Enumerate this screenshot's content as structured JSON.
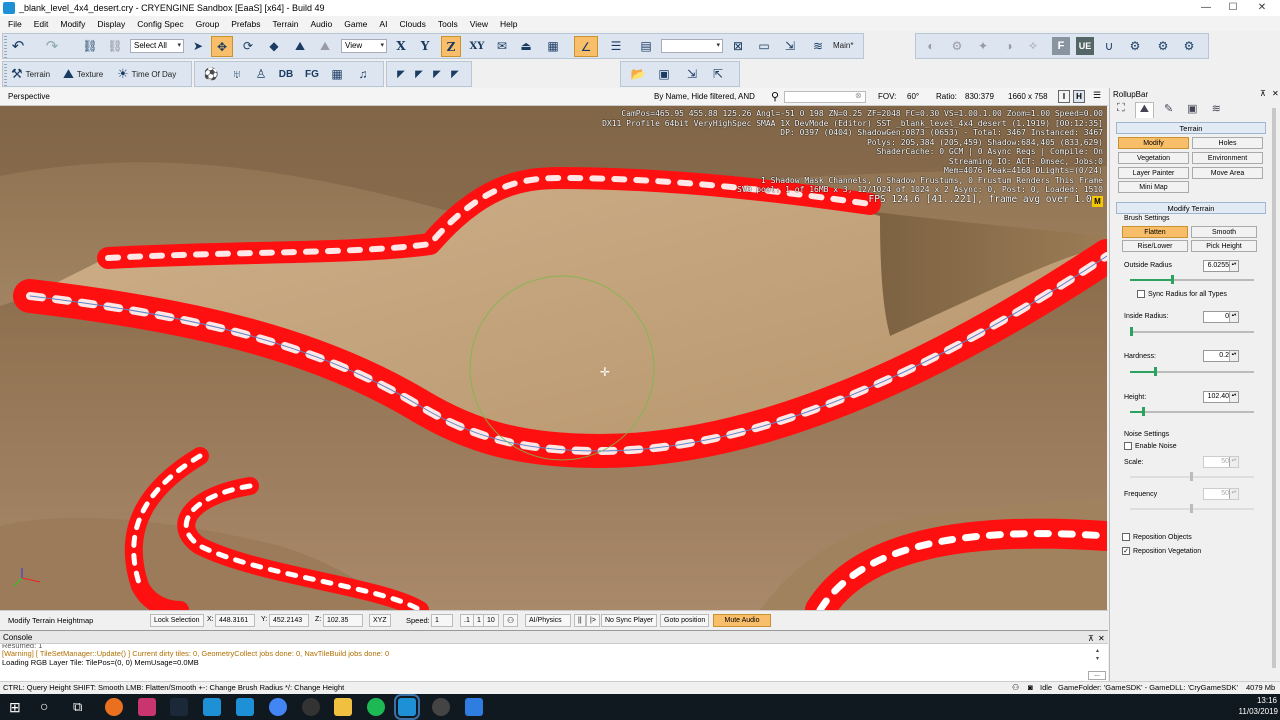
{
  "window": {
    "title": "_blank_level_4x4_desert.cry - CRYENGINE Sandbox [EaaS] [x64] - Build 49",
    "min": "—",
    "max": "☐",
    "close": "✕"
  },
  "menu": [
    "File",
    "Edit",
    "Modify",
    "Display",
    "Config Spec",
    "Group",
    "Prefabs",
    "Terrain",
    "Audio",
    "Game",
    "AI",
    "Clouds",
    "Tools",
    "View",
    "Help"
  ],
  "toolbar": {
    "select_all": "Select All",
    "view_combo": "View",
    "axis_x": "X",
    "axis_y": "Y",
    "axis_z": "Z",
    "axis_xy": "XY",
    "main": "Main*",
    "terrain": "Terrain",
    "texture": "Texture",
    "time_of_day": "Time Of Day",
    "db": "DB",
    "fg": "FG"
  },
  "viewport": {
    "name": "Perspective",
    "filter": "By Name, Hide filtered, AND",
    "fov_label": "FOV:",
    "fov": "60°",
    "ratio_label": "Ratio:",
    "ratio": "830:379",
    "resolution": "1660 x 758",
    "i": "I",
    "h": "H",
    "m": "M"
  },
  "stats": [
    "CamPos=465.95 455.88 125.26 Angl=-51  0 198 ZN=0.25 ZF=2048 FC=0.30 VS=1.00.1.00 Zoom=1.00 Speed=0.00",
    "DX11 Profile 64bit VeryHighSpec SMAA 1X DevMode (Editor) SST _blank_level_4x4_desert (1.1919) [00:12:35]",
    "DP: 0397 (0404) ShadowGen:0873 (0653) - Total: 3467 Instanced: 3467",
    "Polys: 205,384 (205,459) Shadow:684,405 (833,629)",
    "ShaderCache: 0 GCM | 0 Async Reqs | Compile: On",
    "Streaming IO: ACT: 0msec, Jobs:0",
    "Mem=4076 Peak=4168 DLights=(0/24)",
    "1 Shadow Mask Channels,   0 Shadow Frustums,   0 Frustum Renders This Frame",
    "SVO pool:  1 of 16MB x 3,  12/1024 of 1024 x 2   Async:  0, Post:  0, Loaded: 1510",
    "FPS 124.6 [41..221], frame avg over 1.0 s"
  ],
  "status_row": {
    "mode": "Modify Terrain Heightmap",
    "lock": "Lock Selection",
    "x_label": "X:",
    "x": "448.3161",
    "y_label": "Y:",
    "y": "452.2143",
    "z_label": "Z:",
    "z": "102.35",
    "xyz": "XYZ",
    "speed_label": "Speed:",
    "speed": "1",
    ".1": ".1",
    "1": "1",
    "10": "10",
    "ai": "AI/Physics",
    "pause": "||",
    "step": "|>",
    "nosync": "No Sync Player",
    "goto": "Goto position",
    "mute": "Mute Audio"
  },
  "console": {
    "title": "Console",
    "lines": [
      "Resumed: 1",
      "[Warning] [ TileSetManager::Update() ] Current dirty tiles: 0, GeometryCollect jobs done: 0, NavTileBuild jobs done: 0",
      "Loading RGB Layer Tile: TilePos=(0, 0) MemUsage=0.0MB"
    ],
    "pin": "⊼",
    "close": "✕",
    "more": "..."
  },
  "bottom": {
    "hint": "CTRL: Query Height  SHIFT: Smooth  LMB: Flatten/Smooth  +-: Change Brush Radius  */: Change Height",
    "idle": "Idle",
    "folder": "GameFolder: 'GameSDK' - GameDLL: 'CryGameSDK'",
    "mem": "4079 Mb"
  },
  "taskbar": {
    "time": "13:16",
    "date": "11/03/2019"
  },
  "rollup": {
    "title": "RollupBar",
    "terrain": "Terrain",
    "tabs": [
      "Modify",
      "Holes",
      "Vegetation",
      "Environment",
      "Layer Painter",
      "Move Area",
      "Mini Map"
    ],
    "modify_terrain": "Modify Terrain",
    "brush_settings": "Brush Settings",
    "brush_buttons": [
      "Flatten",
      "Smooth",
      "Rise/Lower",
      "Pick Height"
    ],
    "outside_radius_label": "Outside Radius",
    "outside_radius": "6.0255",
    "outside_radius_frac": 0.34,
    "sync": "Sync Radius for all Types",
    "inside_radius_label": "Inside Radius:",
    "inside_radius": "0",
    "inside_radius_frac": 0.0,
    "hardness_label": "Hardness:",
    "hardness": "0.2",
    "hardness_frac": 0.2,
    "height_label": "Height:",
    "height": "102.40",
    "height_frac": 0.1,
    "noise_settings": "Noise Settings",
    "enable_noise": "Enable Noise",
    "scale_label": "Scale:",
    "scale": "50",
    "frequency_label": "Frequency",
    "frequency": "50",
    "reposition_objects": "Reposition Objects",
    "reposition_vegetation": "Reposition Vegetation"
  },
  "colors": {
    "accent": "#f9be6a",
    "road": "#ff1010",
    "sand": "#b99b73"
  }
}
